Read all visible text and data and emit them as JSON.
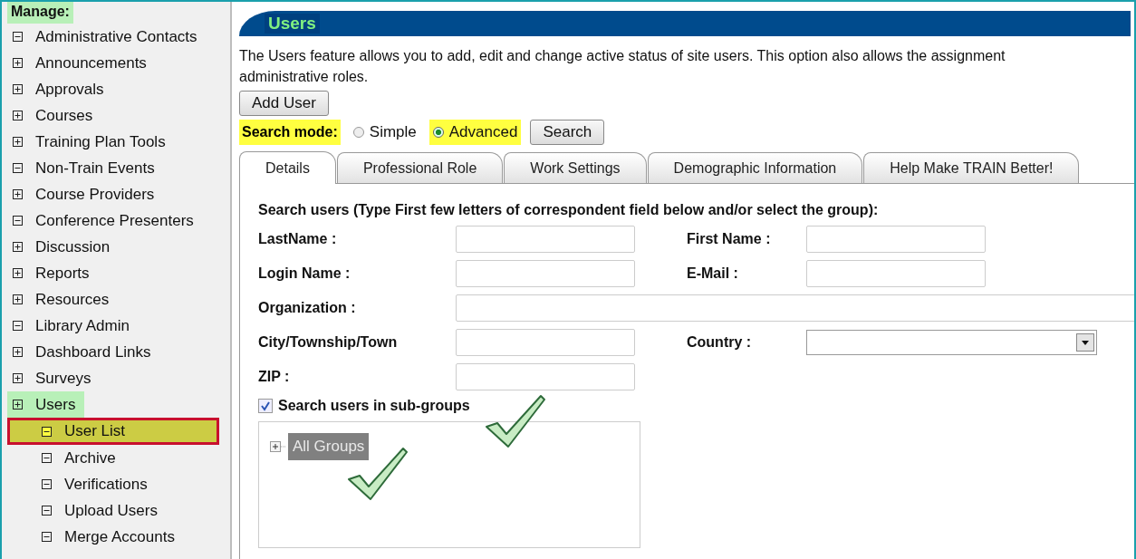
{
  "sidebar": {
    "heading": "Manage:",
    "items": [
      {
        "label": "Administrative Contacts",
        "expanded": true,
        "highlighted": false,
        "selected": false
      },
      {
        "label": "Announcements",
        "expanded": false,
        "highlighted": false,
        "selected": false
      },
      {
        "label": "Approvals",
        "expanded": false,
        "highlighted": false,
        "selected": false
      },
      {
        "label": "Courses",
        "expanded": false,
        "highlighted": false,
        "selected": false
      },
      {
        "label": "Training Plan Tools",
        "expanded": false,
        "highlighted": false,
        "selected": false
      },
      {
        "label": "Non-Train Events",
        "expanded": true,
        "highlighted": false,
        "selected": false
      },
      {
        "label": "Course Providers",
        "expanded": false,
        "highlighted": false,
        "selected": false
      },
      {
        "label": "Conference Presenters",
        "expanded": true,
        "highlighted": false,
        "selected": false
      },
      {
        "label": "Discussion",
        "expanded": false,
        "highlighted": false,
        "selected": false
      },
      {
        "label": "Reports",
        "expanded": false,
        "highlighted": false,
        "selected": false
      },
      {
        "label": "Resources",
        "expanded": false,
        "highlighted": false,
        "selected": false
      },
      {
        "label": "Library Admin",
        "expanded": true,
        "highlighted": false,
        "selected": false
      },
      {
        "label": "Dashboard Links",
        "expanded": false,
        "highlighted": false,
        "selected": false
      },
      {
        "label": "Surveys",
        "expanded": false,
        "highlighted": false,
        "selected": false
      },
      {
        "label": "Users",
        "expanded": false,
        "highlighted": true,
        "selected": false,
        "children": [
          {
            "label": "User List",
            "expanded": true,
            "highlighted": false,
            "selected": true
          },
          {
            "label": "Archive",
            "expanded": true,
            "highlighted": false,
            "selected": false
          },
          {
            "label": "Verifications",
            "expanded": true,
            "highlighted": false,
            "selected": false
          },
          {
            "label": "Upload Users",
            "expanded": true,
            "highlighted": false,
            "selected": false
          },
          {
            "label": "Merge Accounts",
            "expanded": true,
            "highlighted": false,
            "selected": false
          }
        ]
      }
    ]
  },
  "page_title": "Users",
  "description": "The Users feature allows you to add, edit and change active status of site users. This option also allows the assignment\nadministrative roles.",
  "add_button": "Add User",
  "search_mode": {
    "label": "Search mode:",
    "options": [
      {
        "label": "Simple",
        "selected": false
      },
      {
        "label": "Advanced",
        "selected": true
      }
    ],
    "button": "Search"
  },
  "tabs": [
    {
      "label": "Details",
      "selected": true
    },
    {
      "label": "Professional Role",
      "selected": false
    },
    {
      "label": "Work Settings",
      "selected": false
    },
    {
      "label": "Demographic Information",
      "selected": false
    },
    {
      "label": "Help Make TRAIN Better!",
      "selected": false
    }
  ],
  "form": {
    "instruction": "Search users (Type First few letters of correspondent field below and/or select the group):",
    "rows": [
      {
        "fields": [
          {
            "label": "LastName :",
            "kind": "text"
          },
          {
            "label": "First Name :",
            "kind": "text"
          }
        ]
      },
      {
        "fields": [
          {
            "label": "Login Name :",
            "kind": "text"
          },
          {
            "label": "E-Mail :",
            "kind": "text"
          }
        ]
      },
      {
        "fields": [
          {
            "label": "Organization :",
            "kind": "wide"
          }
        ]
      },
      {
        "fields": [
          {
            "label": "City/Township/Town",
            "kind": "text"
          },
          {
            "label": "Country :",
            "kind": "select"
          }
        ]
      },
      {
        "fields": [
          {
            "label": "ZIP :",
            "kind": "text"
          }
        ]
      }
    ],
    "subgroups": {
      "label": "Search users in sub-groups",
      "checked": true
    },
    "tree": {
      "label": "All Groups",
      "selected": true,
      "expanded": false
    }
  }
}
